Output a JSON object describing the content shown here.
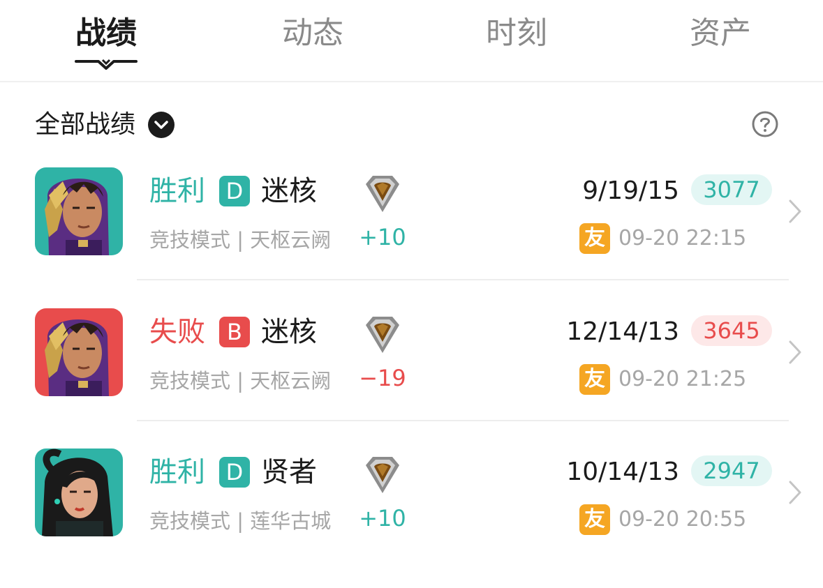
{
  "tabs": [
    {
      "label": "战绩",
      "active": true
    },
    {
      "label": "动态",
      "active": false
    },
    {
      "label": "时刻",
      "active": false
    },
    {
      "label": "资产",
      "active": false
    }
  ],
  "filter": {
    "label": "全部战绩",
    "icon": "chevron-down-icon"
  },
  "help_icon": "question-circle-icon",
  "colors": {
    "win": "#2fb3a6",
    "loss": "#e84c4c",
    "friend": "#f5a623",
    "muted": "#a6a6a6"
  },
  "matches": [
    {
      "result": "胜利",
      "outcome": "win",
      "grade": "D",
      "map": "迷核",
      "mode": "竞技模式 | 天枢云阙",
      "rank_change": "+10",
      "kda": "9/19/15",
      "score": "3077",
      "friend_badge": "友",
      "time": "09-20 22:15",
      "agent_icon": "hooded-agent-avatar",
      "avatar_bg": "#2fb3a6"
    },
    {
      "result": "失败",
      "outcome": "loss",
      "grade": "B",
      "map": "迷核",
      "mode": "竞技模式 | 天枢云阙",
      "rank_change": "−19",
      "kda": "12/14/13",
      "score": "3645",
      "friend_badge": "友",
      "time": "09-20 21:25",
      "agent_icon": "hooded-agent-avatar",
      "avatar_bg": "#e84c4c"
    },
    {
      "result": "胜利",
      "outcome": "win",
      "grade": "D",
      "map": "贤者",
      "mode": "竞技模式 | 莲华古城",
      "rank_change": "+10",
      "kda": "10/14/13",
      "score": "2947",
      "friend_badge": "友",
      "time": "09-20 20:55",
      "agent_icon": "female-agent-avatar",
      "avatar_bg": "#2fb3a6"
    }
  ]
}
